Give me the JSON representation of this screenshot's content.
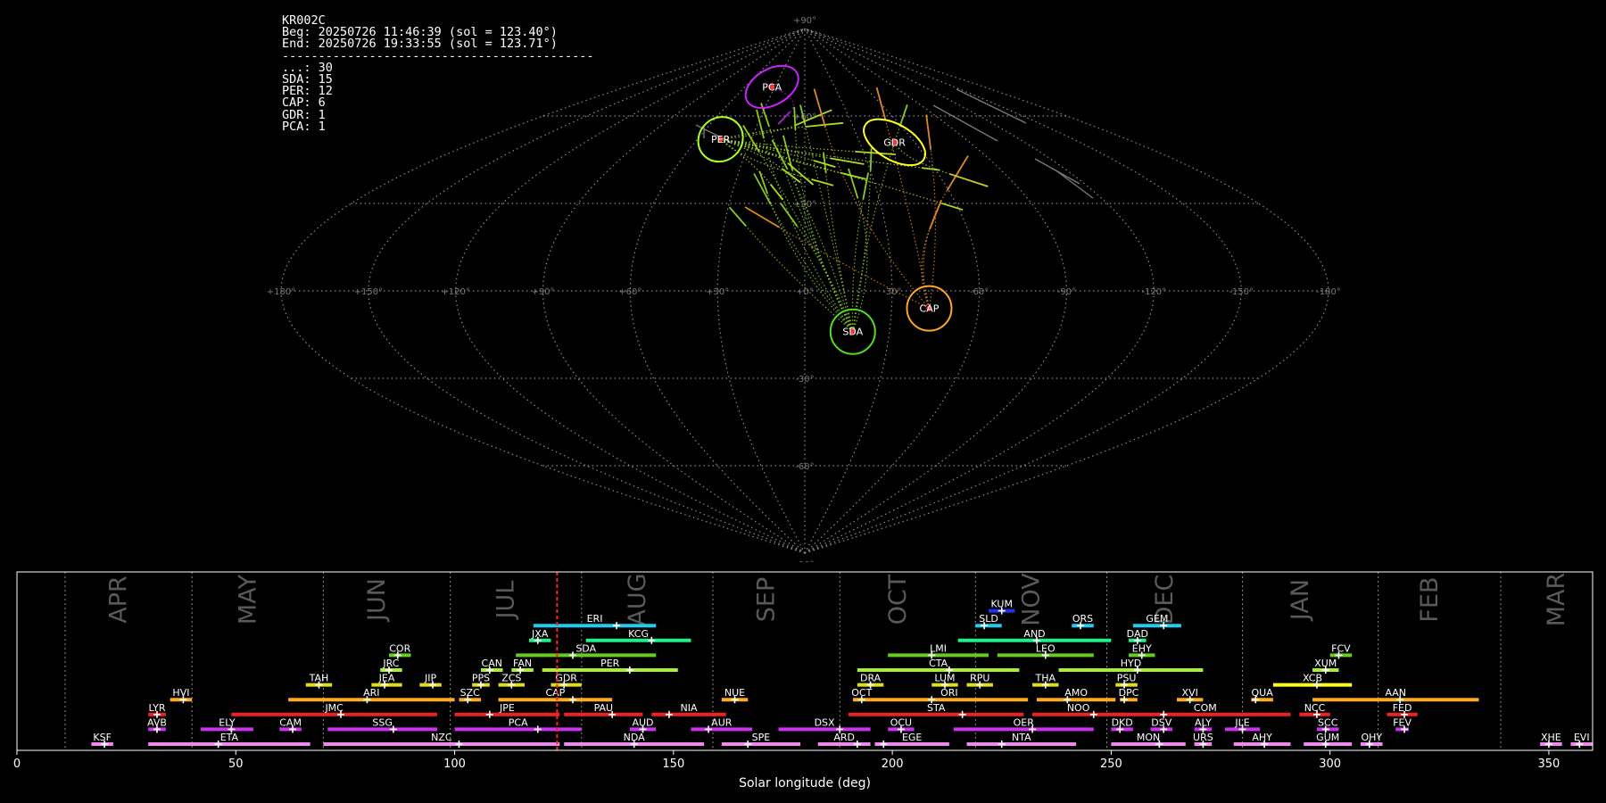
{
  "info": {
    "station": "KR002C",
    "begin": "Beg: 20250726 11:46:39 (sol = 123.40°)",
    "end": "End: 20250726 19:33:55 (sol = 123.71°)",
    "separator": "-------------------------------------------",
    "counts": [
      "...: 30",
      "SDA: 15",
      "PER: 12",
      "CAP: 6",
      "GDR: 1",
      "PCA: 1"
    ]
  },
  "sky_map": {
    "projection": "sinusoidal",
    "lat_labels": [
      "+90°",
      "+60°",
      "+30°",
      "+0°",
      "-30°",
      "-60°",
      "-90°"
    ],
    "lon_labels": [
      "+180°",
      "+150°",
      "+120°",
      "+90°",
      "+60°",
      "+30°",
      "+0°",
      "-30°",
      "-60°",
      "-90°",
      "-120°",
      "-150°",
      "-180°"
    ],
    "radiants": [
      {
        "code": "PCA",
        "lon": 33,
        "lat": 70,
        "color": "#cc22ff"
      },
      {
        "code": "PER",
        "lon": 47,
        "lat": 52,
        "color": "#aaff22"
      },
      {
        "code": "GDR",
        "lon": -49,
        "lat": 51,
        "color": "#ffff22"
      },
      {
        "code": "CAP",
        "lon": -43,
        "lat": -6,
        "color": "#ffaa22"
      },
      {
        "code": "SDA",
        "lon": -17,
        "lat": -14,
        "color": "#55dd22"
      }
    ]
  },
  "chart_data": {
    "type": "timeline",
    "xlabel": "Solar longitude (deg)",
    "xlim": [
      0,
      360
    ],
    "xticks": [
      0,
      50,
      100,
      150,
      200,
      250,
      300,
      350
    ],
    "current_sol": 123.4,
    "months": [
      {
        "name": "APR",
        "start": 11
      },
      {
        "name": "MAY",
        "start": 40
      },
      {
        "name": "JUN",
        "start": 70
      },
      {
        "name": "JUL",
        "start": 99
      },
      {
        "name": "AUG",
        "start": 129
      },
      {
        "name": "SEP",
        "start": 159
      },
      {
        "name": "OCT",
        "start": 188
      },
      {
        "name": "NOV",
        "start": 219
      },
      {
        "name": "DEC",
        "start": 249
      },
      {
        "name": "JAN",
        "start": 280
      },
      {
        "name": "FEB",
        "start": 311
      },
      {
        "name": "MAR",
        "start": 339
      }
    ],
    "showers": [
      {
        "code": "KSF",
        "start": 17,
        "end": 22,
        "peak": 20,
        "row": 0,
        "color": "#ee88ee"
      },
      {
        "code": "ETA",
        "start": 30,
        "end": 67,
        "peak": 46,
        "row": 0,
        "color": "#ee88ee"
      },
      {
        "code": "NZC",
        "start": 70,
        "end": 124,
        "peak": 101,
        "row": 0,
        "color": "#ee88ee"
      },
      {
        "code": "NDA",
        "start": 125,
        "end": 157,
        "peak": 141,
        "row": 0,
        "color": "#ee88ee"
      },
      {
        "code": "SPE",
        "start": 161,
        "end": 179,
        "peak": 167,
        "row": 0,
        "color": "#ee88ee"
      },
      {
        "code": "ARD",
        "start": 183,
        "end": 195,
        "peak": 192,
        "row": 0,
        "color": "#ee88ee"
      },
      {
        "code": "EGE",
        "start": 196,
        "end": 213,
        "peak": 198,
        "row": 0,
        "color": "#ee88ee"
      },
      {
        "code": "NTA",
        "start": 217,
        "end": 242,
        "peak": 225,
        "row": 0,
        "color": "#ee88ee"
      },
      {
        "code": "MON",
        "start": 250,
        "end": 267,
        "peak": 261,
        "row": 0,
        "color": "#ee88ee"
      },
      {
        "code": "URS",
        "start": 269,
        "end": 273,
        "peak": 271,
        "row": 0,
        "color": "#ee88ee"
      },
      {
        "code": "AHY",
        "start": 278,
        "end": 291,
        "peak": 285,
        "row": 0,
        "color": "#ee88ee"
      },
      {
        "code": "GUM",
        "start": 294,
        "end": 305,
        "peak": 299,
        "row": 0,
        "color": "#ee88ee"
      },
      {
        "code": "OHY",
        "start": 307,
        "end": 312,
        "peak": 309,
        "row": 0,
        "color": "#ee88ee"
      },
      {
        "code": "XHE",
        "start": 348,
        "end": 353,
        "peak": 350,
        "row": 0,
        "color": "#ee88ee"
      },
      {
        "code": "EVI",
        "start": 355,
        "end": 360,
        "peak": 357,
        "row": 0,
        "color": "#ee88ee"
      },
      {
        "code": "AVB",
        "start": 30,
        "end": 34,
        "peak": 32,
        "row": 1,
        "color": "#cc33ee"
      },
      {
        "code": "ELY",
        "start": 42,
        "end": 54,
        "peak": 49,
        "row": 1,
        "color": "#cc33ee"
      },
      {
        "code": "CAM",
        "start": 60,
        "end": 65,
        "peak": 63,
        "row": 1,
        "color": "#cc33ee"
      },
      {
        "code": "SSG",
        "start": 71,
        "end": 96,
        "peak": 86,
        "row": 1,
        "color": "#cc33ee"
      },
      {
        "code": "PCA",
        "start": 100,
        "end": 129,
        "peak": 119,
        "row": 1,
        "color": "#cc33ee"
      },
      {
        "code": "AUD",
        "start": 140,
        "end": 146,
        "peak": 143,
        "row": 1,
        "color": "#cc33ee"
      },
      {
        "code": "AUR",
        "start": 154,
        "end": 168,
        "peak": 158,
        "row": 1,
        "color": "#cc33ee"
      },
      {
        "code": "DSX",
        "start": 174,
        "end": 195,
        "peak": 188,
        "row": 1,
        "color": "#cc33ee"
      },
      {
        "code": "OCU",
        "start": 199,
        "end": 205,
        "peak": 202,
        "row": 1,
        "color": "#cc33ee"
      },
      {
        "code": "OER",
        "start": 214,
        "end": 246,
        "peak": 232,
        "row": 1,
        "color": "#cc33ee"
      },
      {
        "code": "DKD",
        "start": 250,
        "end": 255,
        "peak": 252,
        "row": 1,
        "color": "#cc33ee"
      },
      {
        "code": "DSV",
        "start": 259,
        "end": 264,
        "peak": 262,
        "row": 1,
        "color": "#cc33ee"
      },
      {
        "code": "ALY",
        "start": 269,
        "end": 273,
        "peak": 271,
        "row": 1,
        "color": "#cc33ee"
      },
      {
        "code": "JLE",
        "start": 276,
        "end": 284,
        "peak": 280,
        "row": 1,
        "color": "#cc33ee"
      },
      {
        "code": "SCC",
        "start": 297,
        "end": 302,
        "peak": 299,
        "row": 1,
        "color": "#cc33ee"
      },
      {
        "code": "FEV",
        "start": 315,
        "end": 318,
        "peak": 317,
        "row": 1,
        "color": "#cc33ee"
      },
      {
        "code": "LYR",
        "start": 30,
        "end": 34,
        "peak": 32,
        "row": 2,
        "color": "#ee2222"
      },
      {
        "code": "JMC",
        "start": 49,
        "end": 96,
        "peak": 74,
        "row": 2,
        "color": "#ee2222"
      },
      {
        "code": "JPE",
        "start": 100,
        "end": 124,
        "peak": 108,
        "row": 2,
        "color": "#ee2222"
      },
      {
        "code": "PAU",
        "start": 125,
        "end": 143,
        "peak": 136,
        "row": 2,
        "color": "#ee2222"
      },
      {
        "code": "NIA",
        "start": 145,
        "end": 162,
        "peak": 149,
        "row": 2,
        "color": "#ee2222"
      },
      {
        "code": "STA",
        "start": 190,
        "end": 230,
        "peak": 216,
        "row": 2,
        "color": "#ee2222"
      },
      {
        "code": "NOO",
        "start": 232,
        "end": 253,
        "peak": 246,
        "row": 2,
        "color": "#ee2222"
      },
      {
        "code": "COM",
        "start": 252,
        "end": 291,
        "peak": 262,
        "row": 2,
        "color": "#ee2222"
      },
      {
        "code": "NCC",
        "start": 293,
        "end": 300,
        "peak": 297,
        "row": 2,
        "color": "#ee2222"
      },
      {
        "code": "FED",
        "start": 313,
        "end": 320,
        "peak": 317,
        "row": 2,
        "color": "#ee2222"
      },
      {
        "code": "HVI",
        "start": 35,
        "end": 40,
        "peak": 38,
        "row": 3,
        "color": "#ffaa22"
      },
      {
        "code": "ARI",
        "start": 62,
        "end": 100,
        "peak": 80,
        "row": 3,
        "color": "#ffaa22"
      },
      {
        "code": "SZC",
        "start": 101,
        "end": 106,
        "peak": 103,
        "row": 3,
        "color": "#ffaa22"
      },
      {
        "code": "CAP",
        "start": 110,
        "end": 136,
        "peak": 127,
        "row": 3,
        "color": "#ffaa22"
      },
      {
        "code": "NUE",
        "start": 161,
        "end": 167,
        "peak": 164,
        "row": 3,
        "color": "#ffaa22"
      },
      {
        "code": "OCT",
        "start": 191,
        "end": 195,
        "peak": 193,
        "row": 3,
        "color": "#ffaa22"
      },
      {
        "code": "ORI",
        "start": 195,
        "end": 231,
        "peak": 209,
        "row": 3,
        "color": "#ffaa22"
      },
      {
        "code": "AMO",
        "start": 233,
        "end": 251,
        "peak": 240,
        "row": 3,
        "color": "#ffaa22"
      },
      {
        "code": "DPC",
        "start": 252,
        "end": 256,
        "peak": 253,
        "row": 3,
        "color": "#ffaa22"
      },
      {
        "code": "XVI",
        "start": 265,
        "end": 271,
        "peak": 268,
        "row": 3,
        "color": "#ffaa22"
      },
      {
        "code": "QUA",
        "start": 282,
        "end": 287,
        "peak": 283,
        "row": 3,
        "color": "#ffaa22"
      },
      {
        "code": "AAN",
        "start": 296,
        "end": 334,
        "peak": 316,
        "row": 3,
        "color": "#ffaa22"
      },
      {
        "code": "TAH",
        "start": 66,
        "end": 72,
        "peak": 69,
        "row": 4,
        "color": "#dddd22"
      },
      {
        "code": "JEA",
        "start": 81,
        "end": 88,
        "peak": 84,
        "row": 4,
        "color": "#dddd22"
      },
      {
        "code": "JIP",
        "start": 92,
        "end": 97,
        "peak": 95,
        "row": 4,
        "color": "#dddd22"
      },
      {
        "code": "PPS",
        "start": 104,
        "end": 108,
        "peak": 106,
        "row": 4,
        "color": "#dddd22"
      },
      {
        "code": "ZCS",
        "start": 110,
        "end": 116,
        "peak": 113,
        "row": 4,
        "color": "#dddd22"
      },
      {
        "code": "GDR",
        "start": 122,
        "end": 129,
        "peak": 125,
        "row": 4,
        "color": "#dddd22"
      },
      {
        "code": "DRA",
        "start": 192,
        "end": 198,
        "peak": 195,
        "row": 4,
        "color": "#dddd22"
      },
      {
        "code": "LUM",
        "start": 209,
        "end": 215,
        "peak": 212,
        "row": 4,
        "color": "#dddd22"
      },
      {
        "code": "RPU",
        "start": 217,
        "end": 223,
        "peak": 220,
        "row": 4,
        "color": "#dddd22"
      },
      {
        "code": "THA",
        "start": 232,
        "end": 238,
        "peak": 235,
        "row": 4,
        "color": "#dddd22"
      },
      {
        "code": "PSU",
        "start": 251,
        "end": 256,
        "peak": 253,
        "row": 4,
        "color": "#dddd22"
      },
      {
        "code": "XCB",
        "start": 287,
        "end": 305,
        "peak": 297,
        "row": 4,
        "color": "#ffff22"
      },
      {
        "code": "JRC",
        "start": 83,
        "end": 88,
        "peak": 85,
        "row": 5,
        "color": "#aaee33"
      },
      {
        "code": "CAN",
        "start": 106,
        "end": 111,
        "peak": 108,
        "row": 5,
        "color": "#aaee33"
      },
      {
        "code": "FAN",
        "start": 113,
        "end": 118,
        "peak": 115,
        "row": 5,
        "color": "#aaee33"
      },
      {
        "code": "PER",
        "start": 120,
        "end": 151,
        "peak": 140,
        "row": 5,
        "color": "#aaee33"
      },
      {
        "code": "CTA",
        "start": 192,
        "end": 229,
        "peak": 213,
        "row": 5,
        "color": "#aaee33"
      },
      {
        "code": "HYD",
        "start": 238,
        "end": 271,
        "peak": 256,
        "row": 5,
        "color": "#aaee33"
      },
      {
        "code": "XUM",
        "start": 296,
        "end": 302,
        "peak": 299,
        "row": 5,
        "color": "#aaee33"
      },
      {
        "code": "COR",
        "start": 85,
        "end": 90,
        "peak": 87,
        "row": 6,
        "color": "#66cc22"
      },
      {
        "code": "SDA",
        "start": 114,
        "end": 146,
        "peak": 127,
        "row": 6,
        "color": "#66cc22"
      },
      {
        "code": "LMI",
        "start": 199,
        "end": 222,
        "peak": 209,
        "row": 6,
        "color": "#66cc22"
      },
      {
        "code": "LEO",
        "start": 224,
        "end": 246,
        "peak": 235,
        "row": 6,
        "color": "#66cc22"
      },
      {
        "code": "EHY",
        "start": 254,
        "end": 260,
        "peak": 257,
        "row": 6,
        "color": "#66cc22"
      },
      {
        "code": "FCV",
        "start": 300,
        "end": 305,
        "peak": 302,
        "row": 6,
        "color": "#66cc22"
      },
      {
        "code": "JXA",
        "start": 117,
        "end": 122,
        "peak": 119,
        "row": 7,
        "color": "#22ee88"
      },
      {
        "code": "KCG",
        "start": 130,
        "end": 154,
        "peak": 145,
        "row": 7,
        "color": "#22ee88"
      },
      {
        "code": "AND",
        "start": 215,
        "end": 250,
        "peak": 233,
        "row": 7,
        "color": "#22ee88"
      },
      {
        "code": "DAD",
        "start": 254,
        "end": 258,
        "peak": 256,
        "row": 7,
        "color": "#22ee88"
      },
      {
        "code": "ERI",
        "start": 118,
        "end": 146,
        "peak": 137,
        "row": 8,
        "color": "#22ccee"
      },
      {
        "code": "SLD",
        "start": 219,
        "end": 225,
        "peak": 221,
        "row": 8,
        "color": "#22ccee"
      },
      {
        "code": "ORS",
        "start": 241,
        "end": 246,
        "peak": 243,
        "row": 8,
        "color": "#22ccee"
      },
      {
        "code": "GEM",
        "start": 255,
        "end": 266,
        "peak": 262,
        "row": 8,
        "color": "#22ccee"
      },
      {
        "code": "KUM",
        "start": 222,
        "end": 228,
        "peak": 225,
        "row": 9,
        "color": "#2233ee"
      }
    ]
  }
}
